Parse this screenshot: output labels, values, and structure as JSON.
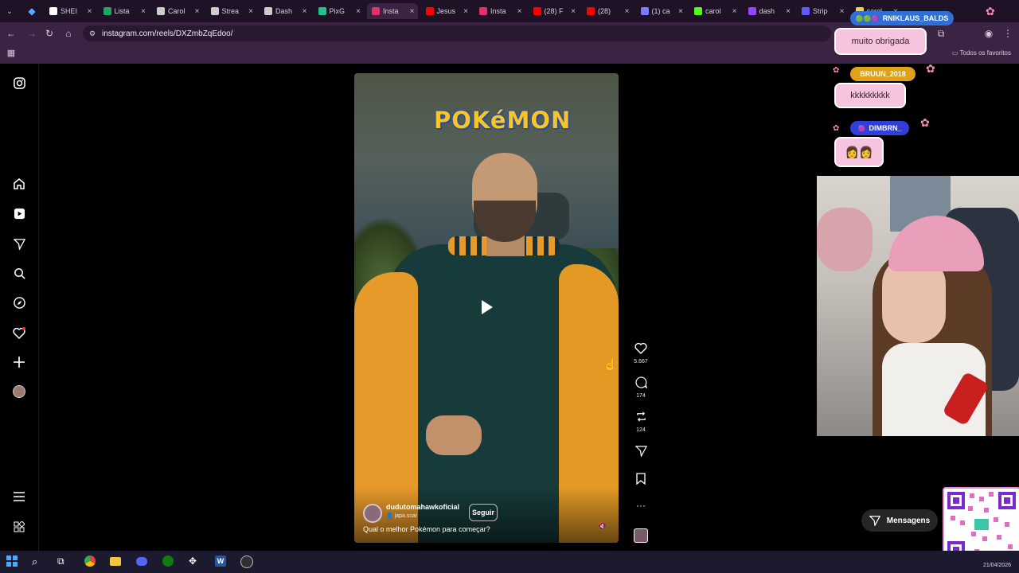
{
  "browser": {
    "tabs": [
      {
        "label": "SHEI",
        "color": "#ffffff"
      },
      {
        "label": "Lista",
        "color": "#1fa463"
      },
      {
        "label": "Carol",
        "color": "#cccccc"
      },
      {
        "label": "Strea",
        "color": "#cccccc"
      },
      {
        "label": "Dash",
        "color": "#cccccc"
      },
      {
        "label": "PixG",
        "color": "#22c38a"
      },
      {
        "label": "Insta",
        "color": "#e1306c"
      },
      {
        "label": "Jesus",
        "color": "#ff0000"
      },
      {
        "label": "Insta",
        "color": "#e1306c"
      },
      {
        "label": "(28) F",
        "color": "#ff0000"
      },
      {
        "label": "(28)",
        "color": "#ff0000"
      },
      {
        "label": "(1) ca",
        "color": "#7b7bff"
      },
      {
        "label": "carol",
        "color": "#53fc18"
      },
      {
        "label": "dash",
        "color": "#9146ff"
      },
      {
        "label": "Strip",
        "color": "#635bff"
      },
      {
        "label": "carol",
        "color": "#f3d33a"
      }
    ],
    "url": "instagram.com/reels/DXZmbZqEdoo/",
    "bookmarks_label": "Todos os favoritos"
  },
  "instagram": {
    "sidebar_icons": [
      "instagram-logo-icon",
      "home-icon",
      "reels-icon",
      "send-icon",
      "search-icon",
      "explore-icon",
      "heart-icon",
      "plus-icon",
      "profile-avatar",
      "menu-icon",
      "apps-icon"
    ],
    "video": {
      "logo_text": "POKéMON",
      "username": "dudutomahawkoficial",
      "audio": "japa.scar",
      "follow_label": "Seguir",
      "caption": "Qual o melhor Pokémon para começar?"
    },
    "actions": {
      "likes": "5.667",
      "comments": "174",
      "reposts": "124"
    },
    "messages_label": "Mensagens"
  },
  "overlay": {
    "chat": [
      {
        "user": "RNIKLAUS_BALDS",
        "message": "muito obrigada"
      },
      {
        "user": "BRUUN_2018",
        "message": "kkkkkkkkk"
      },
      {
        "user": "DIMBRN_",
        "message": "👩👩"
      }
    ]
  },
  "taskbar": {
    "date": "21/04/2026"
  }
}
